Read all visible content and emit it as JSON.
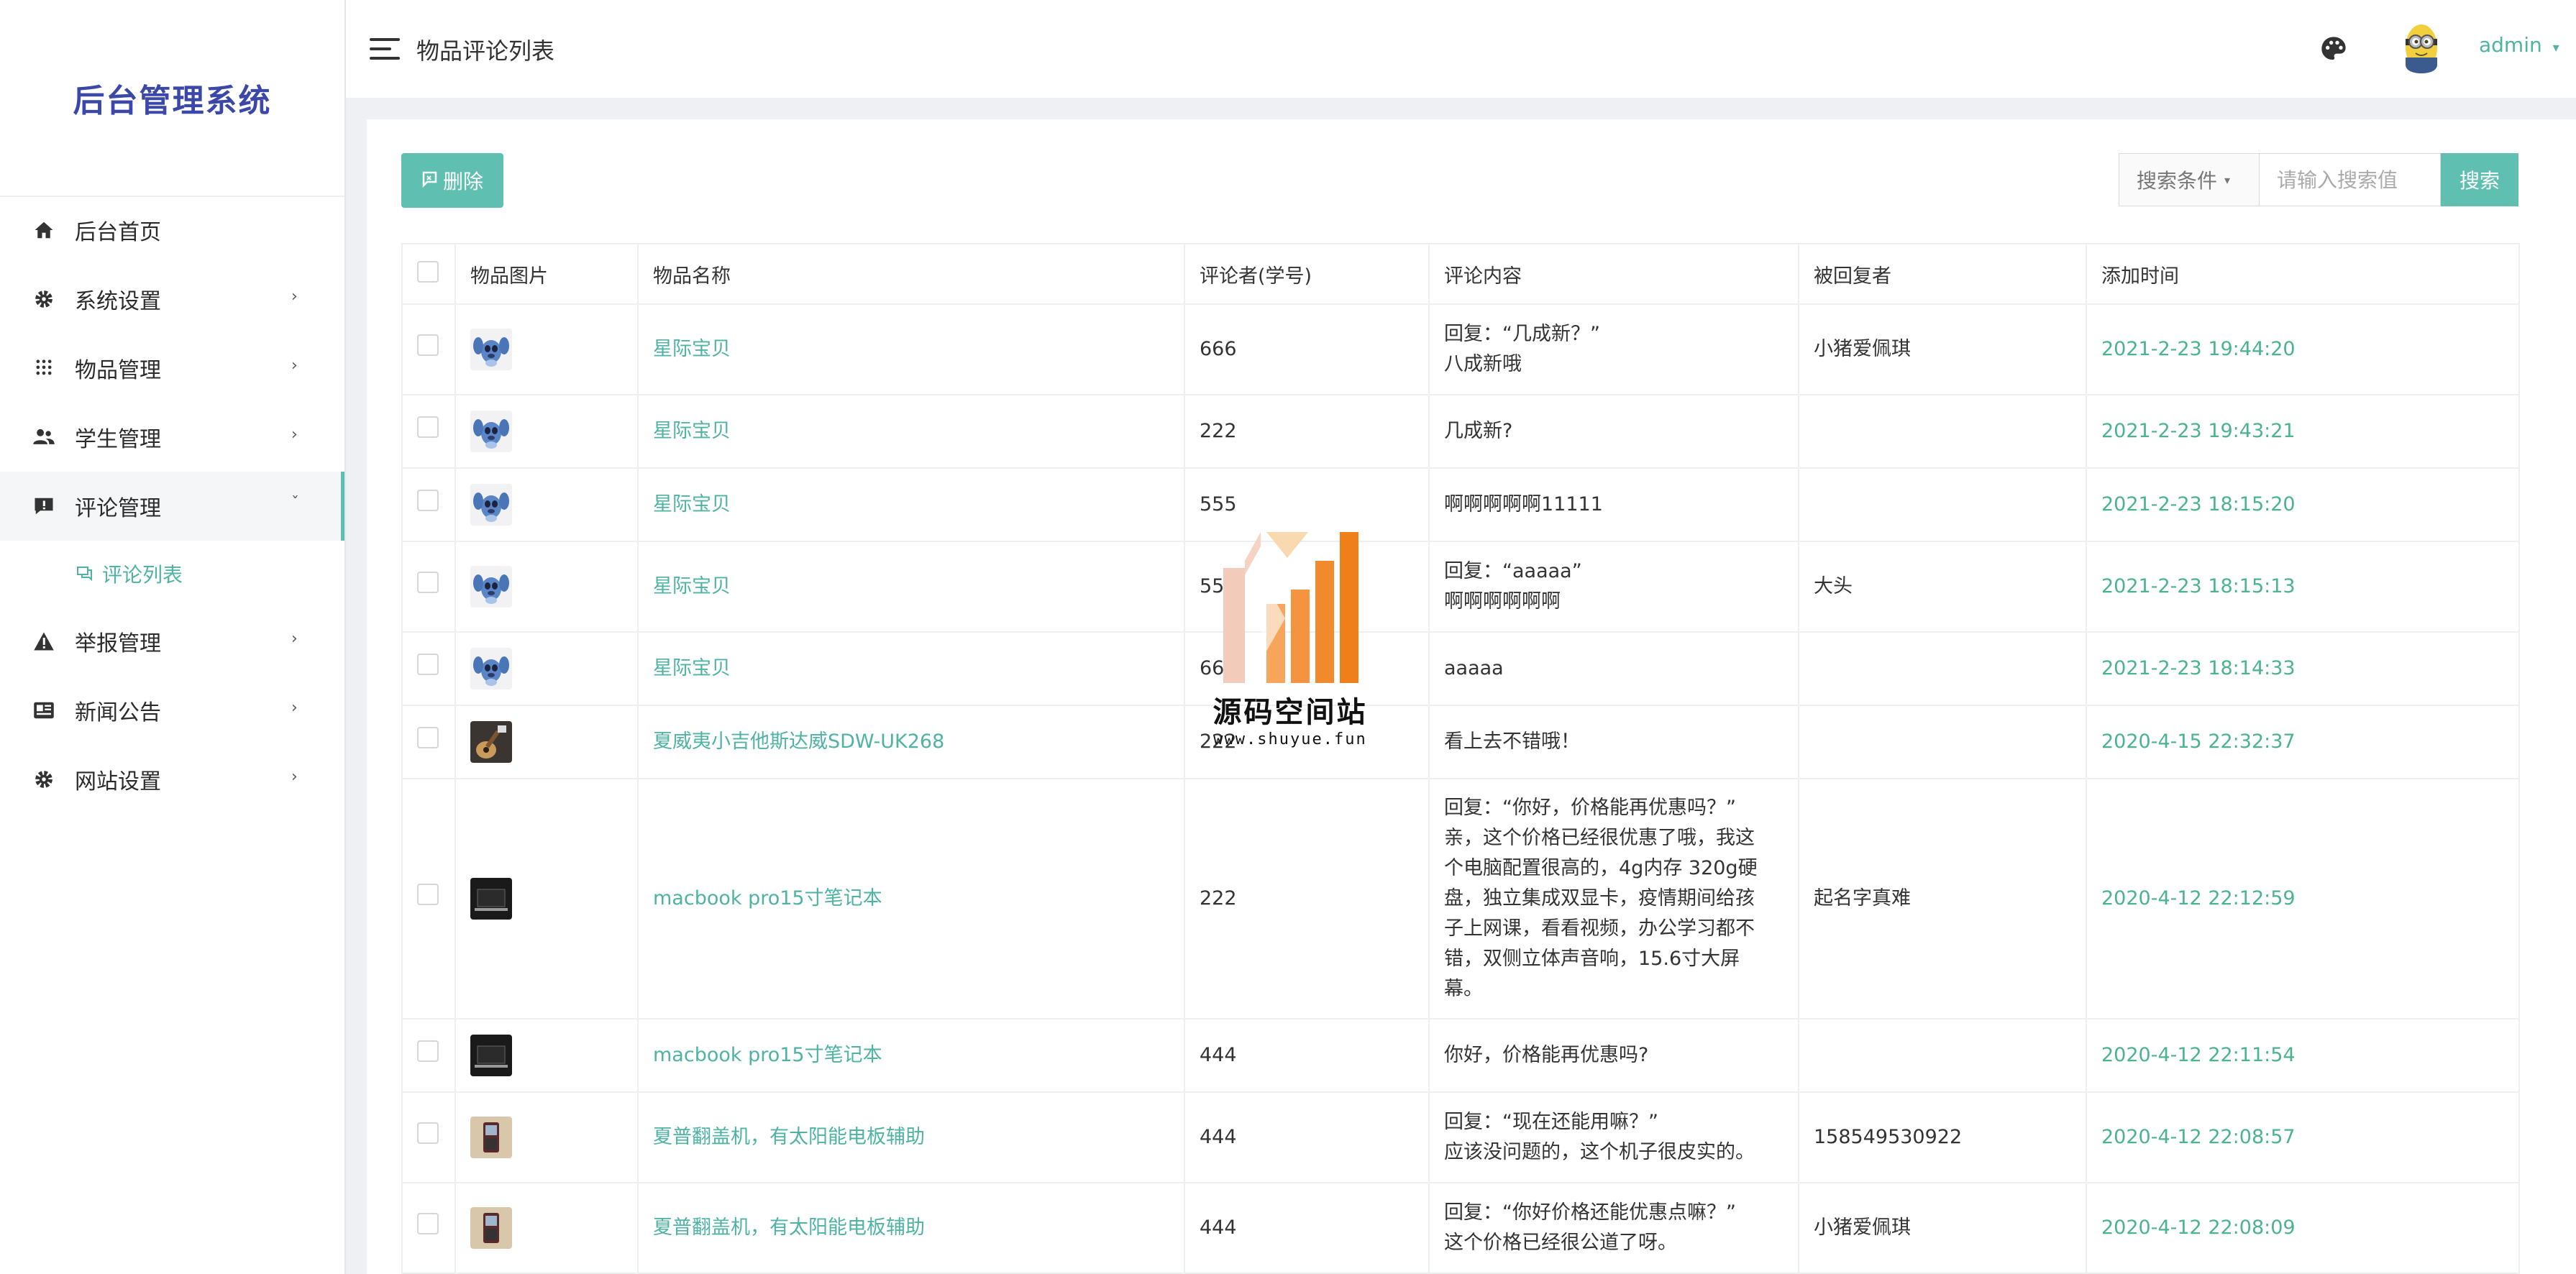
{
  "app": {
    "title": "后台管理系统"
  },
  "sidebar": {
    "items": [
      {
        "label": "后台首页",
        "icon": "home-icon"
      },
      {
        "label": "系统设置",
        "icon": "gear-icon"
      },
      {
        "label": "物品管理",
        "icon": "grid-icon"
      },
      {
        "label": "学生管理",
        "icon": "users-icon"
      },
      {
        "label": "评论管理",
        "icon": "comment-icon"
      },
      {
        "label": "举报管理",
        "icon": "warning-icon"
      },
      {
        "label": "新闻公告",
        "icon": "news-icon"
      },
      {
        "label": "网站设置",
        "icon": "gear-icon"
      }
    ],
    "sub_item": {
      "label": "评论列表",
      "icon": "comments-icon"
    }
  },
  "header": {
    "breadcrumb": "物品评论列表",
    "user": "admin"
  },
  "toolbar": {
    "delete_label": "删除",
    "search_condition": "搜索条件",
    "search_placeholder": "请输入搜索值",
    "search_label": "搜索"
  },
  "table": {
    "columns": [
      "物品图片",
      "物品名称",
      "评论者(学号)",
      "评论内容",
      "被回复者",
      "添加时间"
    ],
    "rows": [
      {
        "thumb": "stitch",
        "name": "星际宝贝",
        "commenter": "666",
        "content": [
          "回复：“几成新？”",
          "八成新哦"
        ],
        "reply_to": "小猪爱佩琪",
        "time": "2021-2-23 19:44:20"
      },
      {
        "thumb": "stitch",
        "name": "星际宝贝",
        "commenter": "222",
        "content": [
          "几成新?"
        ],
        "reply_to": "",
        "time": "2021-2-23 19:43:21"
      },
      {
        "thumb": "stitch",
        "name": "星际宝贝",
        "commenter": "555",
        "content": [
          "啊啊啊啊啊11111"
        ],
        "reply_to": "",
        "time": "2021-2-23 18:15:20"
      },
      {
        "thumb": "stitch",
        "name": "星际宝贝",
        "commenter": "555",
        "content": [
          "回复：“aaaaa”",
          "啊啊啊啊啊啊"
        ],
        "reply_to": "大头",
        "time": "2021-2-23 18:15:13"
      },
      {
        "thumb": "stitch",
        "name": "星际宝贝",
        "commenter": "666",
        "content": [
          "aaaaa"
        ],
        "reply_to": "",
        "time": "2021-2-23 18:14:33"
      },
      {
        "thumb": "guitar",
        "name": "夏威夷小吉他斯达威SDW-UK268",
        "commenter": "222",
        "content": [
          "看上去不错哦！"
        ],
        "reply_to": "",
        "time": "2020-4-15 22:32:37"
      },
      {
        "thumb": "laptop",
        "name": "macbook pro15寸笔记本",
        "commenter": "222",
        "content": [
          "回复：“你好，价格能再优惠吗？”",
          "亲，这个价格已经很优惠了哦，我这",
          "个电脑配置很高的，4g内存 320g硬",
          "盘，独立集成双显卡，疫情期间给孩",
          "子上网课，看看视频，办公学习都不",
          "错，双侧立体声音响，15.6寸大屏",
          "幕。"
        ],
        "reply_to": "起名字真难",
        "time": "2020-4-12 22:12:59"
      },
      {
        "thumb": "laptop",
        "name": "macbook pro15寸笔记本",
        "commenter": "444",
        "content": [
          "你好，价格能再优惠吗?"
        ],
        "reply_to": "",
        "time": "2020-4-12 22:11:54"
      },
      {
        "thumb": "phone",
        "name": "夏普翻盖机，有太阳能电板辅助",
        "commenter": "444",
        "content": [
          "回复：“现在还能用嘛？”",
          "应该没问题的，这个机子很皮实的。"
        ],
        "reply_to": "158549530922",
        "time": "2020-4-12 22:08:57"
      },
      {
        "thumb": "phone",
        "name": "夏普翻盖机，有太阳能电板辅助",
        "commenter": "444",
        "content": [
          "回复：“你好价格还能优惠点嘛？”",
          "这个价格已经很公道了呀。"
        ],
        "reply_to": "小猪爱佩琪",
        "time": "2020-4-12 22:08:09"
      }
    ]
  },
  "watermark": {
    "title": "源码空间站",
    "url": "www.shuyue.fun"
  },
  "colors": {
    "accent": "#5fbfb0",
    "title": "#3b48a8",
    "time": "#4bb38d"
  }
}
